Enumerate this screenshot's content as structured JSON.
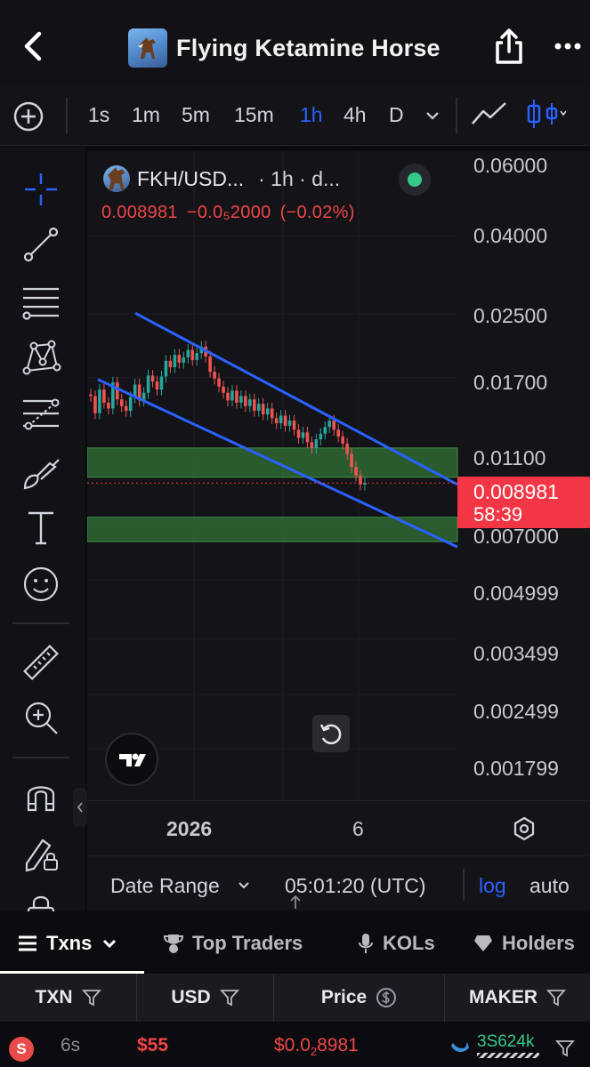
{
  "header": {
    "title": "Flying Ketamine Horse",
    "back_icon": "chevron-left-icon",
    "share_icon": "share-icon",
    "more_icon": "more-horizontal-icon"
  },
  "timeframes": {
    "items": [
      "1s",
      "1m",
      "5m",
      "15m",
      "1h",
      "4h",
      "D"
    ],
    "active": "1h"
  },
  "left_toolbar": {
    "tools": [
      "crosshair-icon",
      "trend-line-icon",
      "horizontal-lines-icon",
      "pattern-icon",
      "fib-retracement-icon",
      "brush-icon",
      "text-icon",
      "emoji-icon",
      "ruler-icon",
      "zoom-in-icon",
      "magnet-icon",
      "lock-drawing-icon",
      "lock-icon"
    ]
  },
  "chart": {
    "symbol": "FKH/USD...",
    "interval": "· 1h · d...",
    "ohlc_price": "0.008981",
    "ohlc_change": "−0.0₅2000",
    "ohlc_pct": "(−0.02%)",
    "y_ticks": [
      "0.06000",
      "0.04000",
      "0.02500",
      "0.01700",
      "0.01100",
      "0.007000",
      "0.004999",
      "0.003499",
      "0.002499",
      "0.001799"
    ],
    "price_tag": {
      "price": "0.008981",
      "countdown": "58:39"
    },
    "x_labels": [
      "2026",
      "6"
    ],
    "colors": {
      "up": "#26a69a",
      "down": "#ef5350",
      "trendline": "#2962ff",
      "zone": "#2e7d32"
    }
  },
  "chart_data": {
    "type": "candlestick",
    "title": "FKH/USD · 1h",
    "y_scale": "log",
    "ylim": [
      0.0016,
      0.062
    ],
    "close_series": [
      0.0152,
      0.0137,
      0.0158,
      0.0146,
      0.0141,
      0.0165,
      0.0149,
      0.0143,
      0.0139,
      0.0151,
      0.0163,
      0.0148,
      0.0155,
      0.0172,
      0.0166,
      0.0158,
      0.0171,
      0.0188,
      0.0181,
      0.0195,
      0.0186,
      0.0192,
      0.0201,
      0.0189,
      0.0197,
      0.0205,
      0.0193,
      0.0176,
      0.0169,
      0.0161,
      0.0155,
      0.0148,
      0.0157,
      0.0146,
      0.0152,
      0.0143,
      0.0149,
      0.0139,
      0.0145,
      0.0136,
      0.0141,
      0.0133,
      0.0129,
      0.0135,
      0.0127,
      0.0131,
      0.0124,
      0.0118,
      0.0122,
      0.0115,
      0.0111,
      0.0117,
      0.0121,
      0.0126,
      0.0131,
      0.0124,
      0.0119,
      0.0114,
      0.0107,
      0.0099,
      0.0094,
      0.0089,
      0.00898
    ],
    "last_price": 0.008981,
    "zones": [
      {
        "from": 0.0093,
        "to": 0.0111
      },
      {
        "from": 0.0063,
        "to": 0.0073
      }
    ],
    "channel": {
      "upper": {
        "from": 0.0251,
        "to": 0.0089
      },
      "lower": {
        "from": 0.0168,
        "to": 0.0061
      }
    }
  },
  "footer": {
    "date_range": "Date Range",
    "time": "05:01:20 (UTC)",
    "log": "log",
    "auto": "auto"
  },
  "tabs": [
    {
      "label": "Txns",
      "icon": "list-icon"
    },
    {
      "label": "Top Traders",
      "icon": "trophy-icon"
    },
    {
      "label": "KOLs",
      "icon": "microphone-icon"
    },
    {
      "label": "Holders",
      "icon": "diamond-icon"
    }
  ],
  "table": {
    "headers": [
      "TXN",
      "USD",
      "Price",
      "MAKER"
    ],
    "row": {
      "side": "S",
      "age": "6s",
      "usd": "$55",
      "price_prefix": "$0.0",
      "price_sub": "2",
      "price_digits": "8981",
      "maker": "3S624k"
    }
  }
}
